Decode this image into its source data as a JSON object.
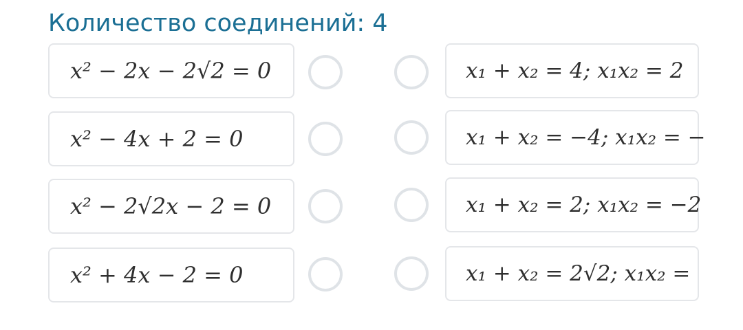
{
  "header": {
    "title": "Количество соединений: 4"
  },
  "left_items": [
    {
      "expr": "x² − 2x − 2√2 = 0"
    },
    {
      "expr": "x² − 4x + 2 = 0"
    },
    {
      "expr": "x² − 2√2x − 2 = 0"
    },
    {
      "expr": "x² + 4x − 2 = 0"
    }
  ],
  "right_items": [
    {
      "expr": "x₁ + x₂ = 4; x₁x₂ = 2"
    },
    {
      "expr": "x₁ + x₂ = −4; x₁x₂ = −"
    },
    {
      "expr": "x₁ + x₂ = 2; x₁x₂ = −2"
    },
    {
      "expr": "x₁ + x₂ = 2√2; x₁x₂ ="
    }
  ],
  "colors": {
    "title": "#1b6f94",
    "card_border": "#e4e6e9",
    "radio_border": "#dfe3e7",
    "text": "#2f2f2f"
  }
}
